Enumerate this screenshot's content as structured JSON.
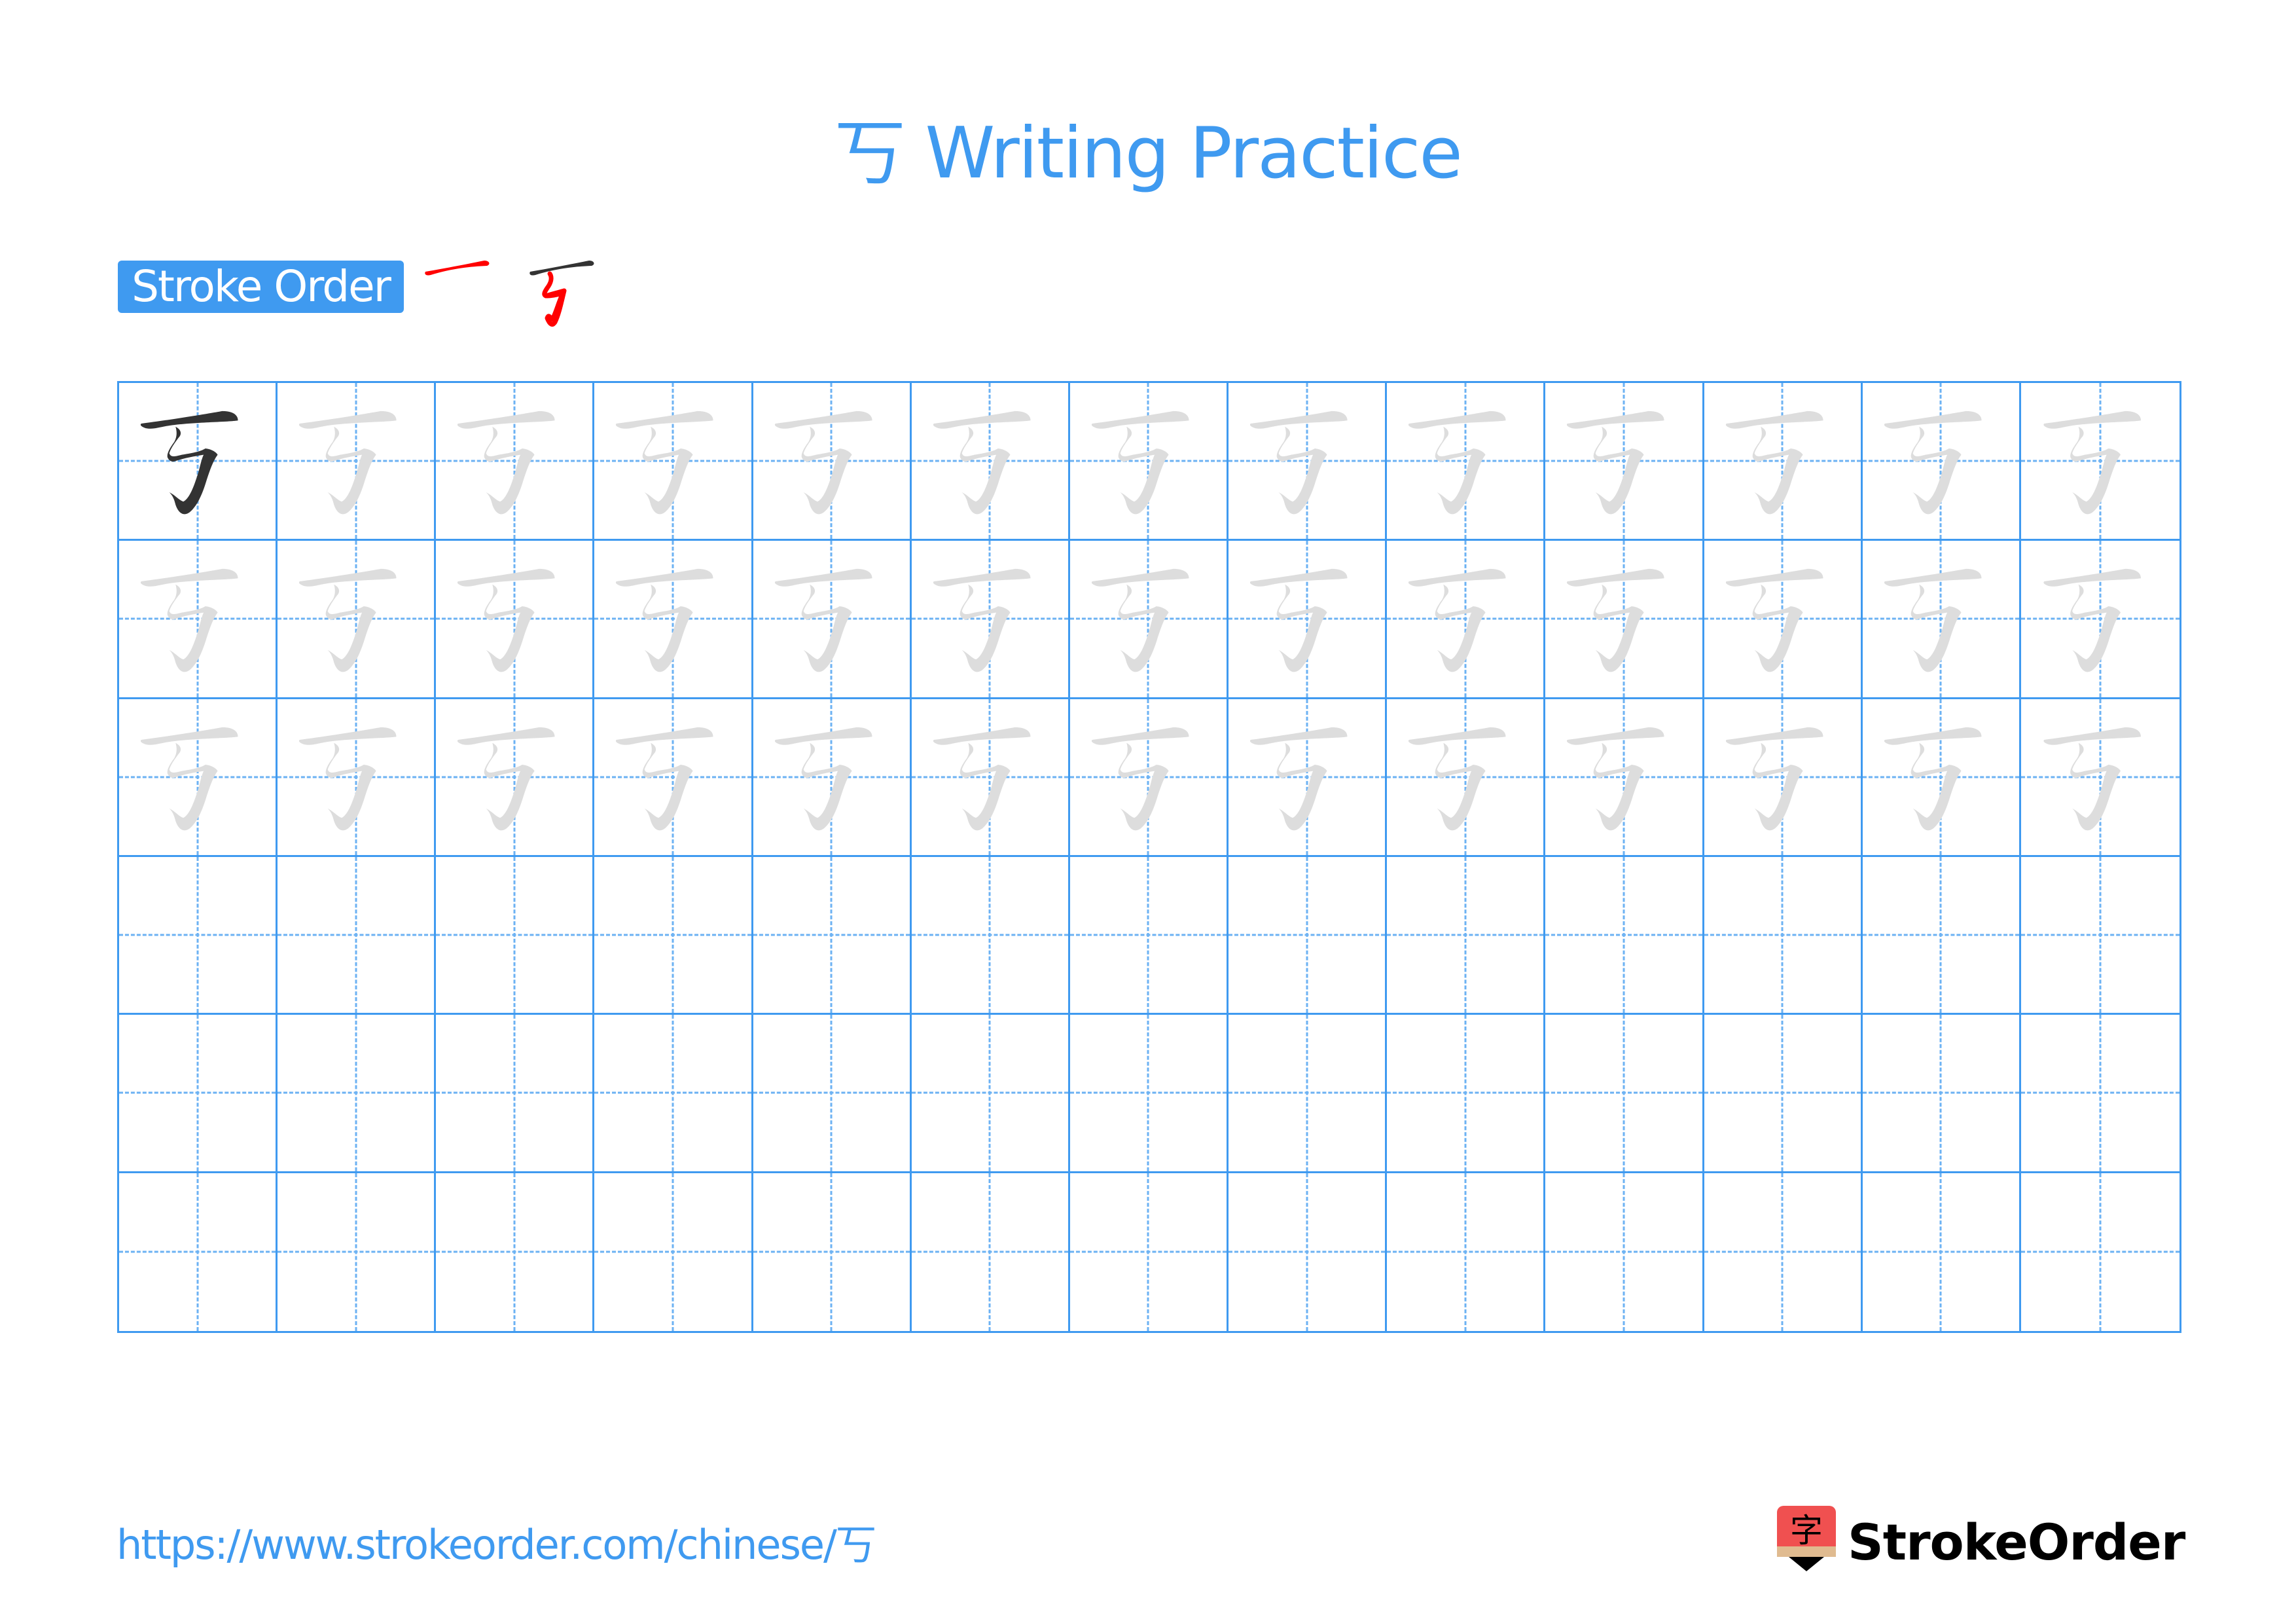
{
  "header": {
    "title": "丂 Writing Practice",
    "character": "丂"
  },
  "stroke_order": {
    "label": "Stroke Order",
    "steps": [
      {
        "step": 1,
        "highlight": "stroke-1"
      },
      {
        "step": 2,
        "highlight": "stroke-2"
      }
    ]
  },
  "grid": {
    "rows": 6,
    "columns": 13,
    "model_cells": 1,
    "trace_rows": 3,
    "blank_rows": 3
  },
  "colors": {
    "accent": "#3f9af0",
    "model": "#333333",
    "trace": "#dddddd",
    "current_stroke": "#ff0000",
    "logo_red": "#f05050",
    "logo_tan": "#e0bb90"
  },
  "footer": {
    "url": "https://www.strokeorder.com/chinese/丂",
    "logo_text": "StrokeOrder",
    "logo_glyph": "字"
  }
}
